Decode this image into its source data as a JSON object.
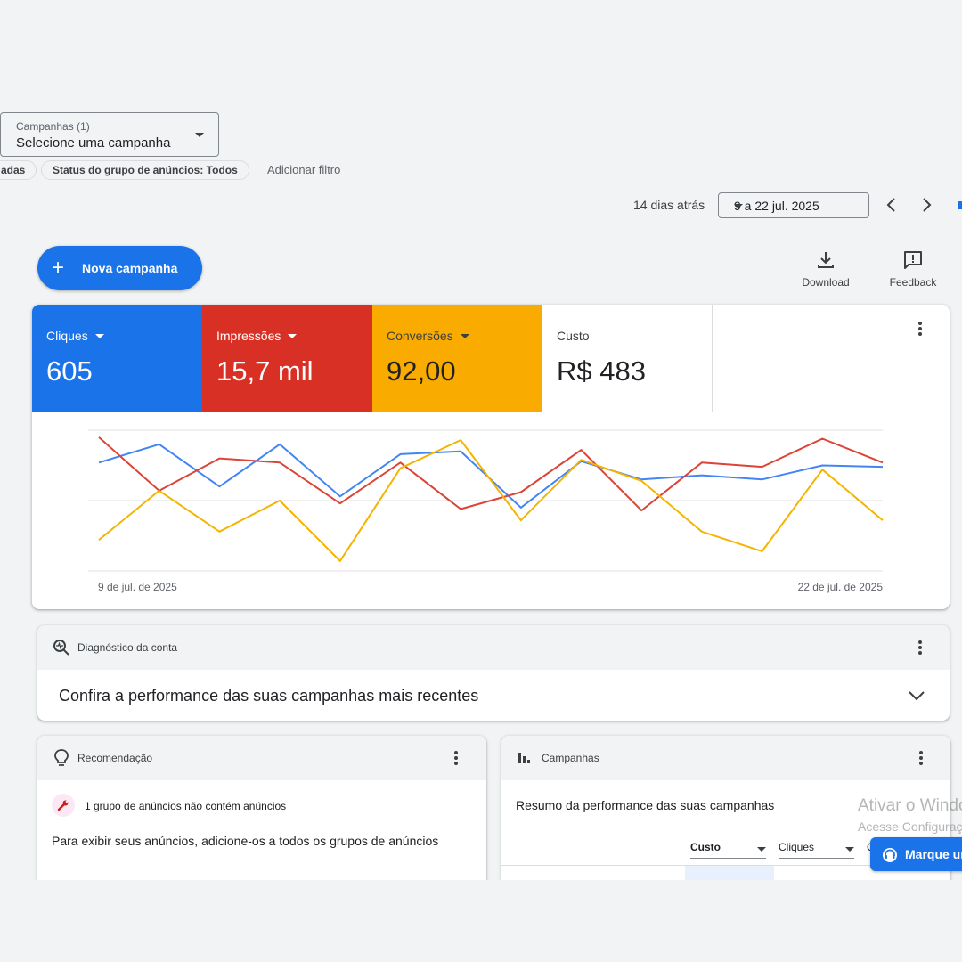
{
  "filters": {
    "campaign_label": "Campanhas (1)",
    "campaign_value": "Selecione uma campanha",
    "chip_partial": "adas",
    "chip_status": "Status do grupo de anúncios: Todos",
    "add_filter": "Adicionar filtro"
  },
  "date_range": {
    "relative": "14 dias atrás",
    "value": "9 a 22 jul. 2025"
  },
  "actions": {
    "new_campaign": "Nova campanha",
    "download": "Download",
    "feedback": "Feedback"
  },
  "metrics": [
    {
      "label": "Cliques",
      "value": "605",
      "color": "#1a73e8"
    },
    {
      "label": "Impressões",
      "value": "15,7 mil",
      "color": "#d93025"
    },
    {
      "label": "Conversões",
      "value": "92,00",
      "color": "#f9ab00"
    },
    {
      "label": "Custo",
      "value": "R$ 483",
      "color": "#ffffff"
    }
  ],
  "chart_data": {
    "type": "line",
    "x_start_label": "9 de jul. de 2025",
    "x_end_label": "22 de jul. de 2025",
    "days": 14,
    "normalized": true,
    "ylim": [
      0,
      1
    ],
    "grid": true,
    "series": [
      {
        "name": "Cliques",
        "color": "#4285f4",
        "values": [
          0.77,
          0.9,
          0.6,
          0.9,
          0.53,
          0.83,
          0.85,
          0.45,
          0.78,
          0.65,
          0.68,
          0.65,
          0.75,
          0.74
        ]
      },
      {
        "name": "Impressões",
        "color": "#db4437",
        "values": [
          0.95,
          0.57,
          0.8,
          0.77,
          0.48,
          0.77,
          0.44,
          0.56,
          0.86,
          0.43,
          0.77,
          0.74,
          0.94,
          0.77
        ]
      },
      {
        "name": "Conversões",
        "color": "#f4b400",
        "values": [
          0.22,
          0.57,
          0.28,
          0.5,
          0.07,
          0.73,
          0.93,
          0.36,
          0.79,
          0.64,
          0.28,
          0.14,
          0.72,
          0.36
        ]
      }
    ]
  },
  "diagnostic": {
    "title": "Diagnóstico da conta",
    "body": "Confira a performance das suas campanhas mais recentes"
  },
  "recommendation": {
    "title": "Recomendação",
    "item": "1 grupo de anúncios não contém anúncios",
    "description": "Para exibir seus anúncios, adicione-os a todos os grupos de anúncios"
  },
  "campaigns_card": {
    "title": "Campanhas",
    "subtitle": "Resumo da performance das suas campanhas",
    "col1": "Custo",
    "col2": "Cliques",
    "col3_partial": "C"
  },
  "overlay": {
    "watermark_title": "Ativar o Windows",
    "watermark_sub": "Acesse Configurações",
    "help_button": "Marque uma"
  }
}
